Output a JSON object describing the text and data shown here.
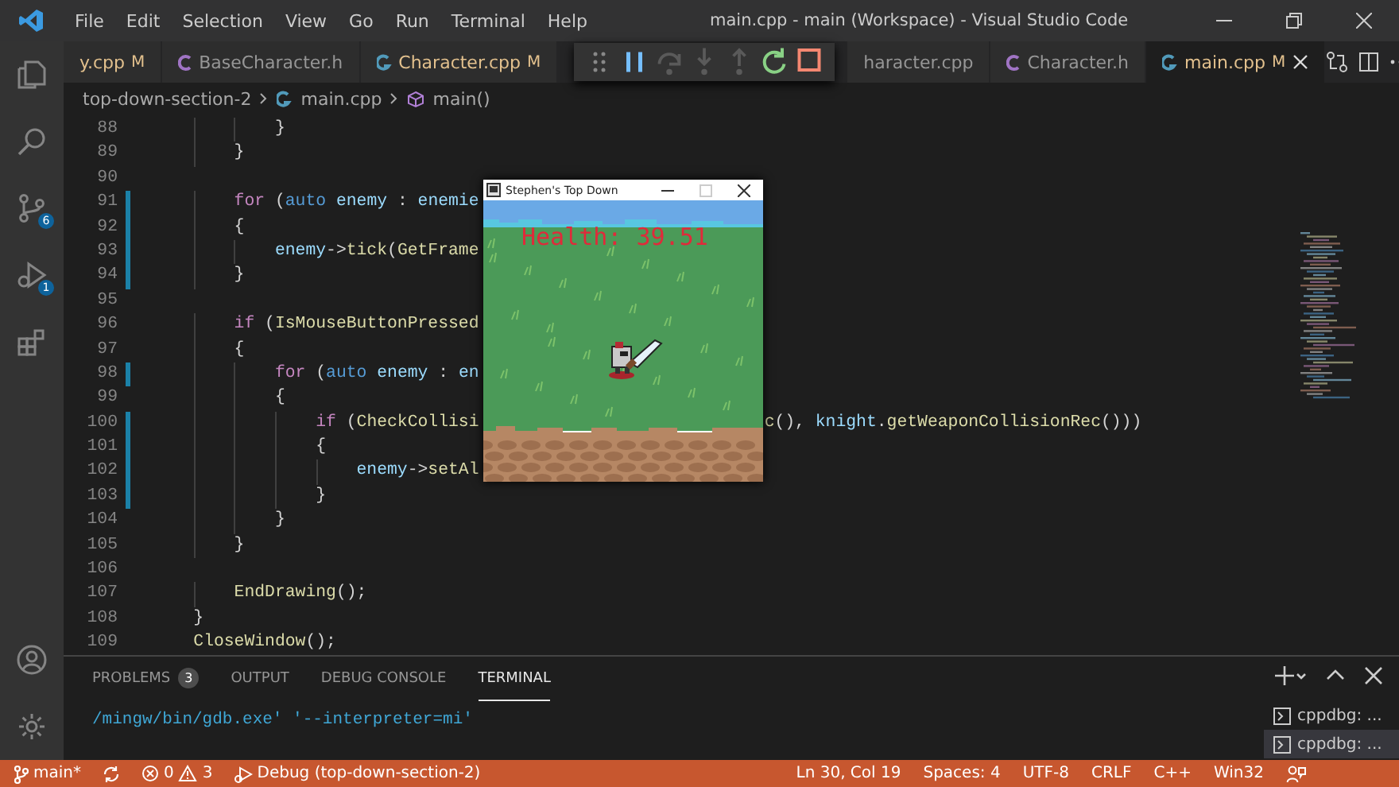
{
  "window": {
    "title": "main.cpp - main (Workspace) - Visual Studio Code"
  },
  "menu": [
    "File",
    "Edit",
    "Selection",
    "View",
    "Go",
    "Run",
    "Terminal",
    "Help"
  ],
  "activity_bar": {
    "top": [
      {
        "kind": "explorer"
      },
      {
        "kind": "search"
      },
      {
        "kind": "source-control",
        "badge": "6"
      },
      {
        "kind": "run-debug",
        "badge": "1"
      },
      {
        "kind": "extensions"
      }
    ],
    "bottom": [
      {
        "kind": "account"
      },
      {
        "kind": "settings"
      }
    ]
  },
  "tabs": [
    {
      "label": "y.cpp",
      "kind": "plain",
      "modified": true,
      "badge": "M",
      "selected": false
    },
    {
      "label": "BaseCharacter.h",
      "kind": "header",
      "modified": false,
      "selected": false
    },
    {
      "label": "Character.cpp",
      "kind": "source",
      "modified": true,
      "badge": "M",
      "selected": false
    },
    {
      "label": "haracter.cpp",
      "kind": "plain",
      "modified": false,
      "selected": false
    },
    {
      "label": "Character.h",
      "kind": "header",
      "modified": false,
      "selected": false
    },
    {
      "label": "main.cpp",
      "kind": "source",
      "modified": true,
      "badge": "M",
      "selected": true
    }
  ],
  "debug_toolbar": [
    {
      "kind": "grip",
      "disabled": false
    },
    {
      "kind": "pause",
      "disabled": false
    },
    {
      "kind": "step-over",
      "disabled": true
    },
    {
      "kind": "step-into",
      "disabled": true
    },
    {
      "kind": "step-out",
      "disabled": true
    },
    {
      "kind": "restart",
      "disabled": false
    },
    {
      "kind": "stop",
      "disabled": false
    }
  ],
  "breadcrumb": {
    "folder": "top-down-section-2",
    "file": "main.cpp",
    "symbol": "main()"
  },
  "code_lines": [
    {
      "number": "88",
      "changed": false,
      "tokens": [
        {
          "kind": "punct",
          "text": "            }"
        }
      ]
    },
    {
      "number": "89",
      "changed": false,
      "tokens": [
        {
          "kind": "punct",
          "text": "        }"
        }
      ]
    },
    {
      "number": "90",
      "changed": false
    },
    {
      "number": "91",
      "changed": true,
      "tokens": [
        {
          "kind": "keyword",
          "text": "        for"
        },
        {
          "kind": "punct",
          "text": " ("
        },
        {
          "kind": "type",
          "text": "auto"
        },
        {
          "kind": "var",
          "text": " enemy"
        },
        {
          "kind": "punct",
          "text": " : "
        },
        {
          "kind": "var",
          "text": "enemie"
        }
      ]
    },
    {
      "number": "92",
      "changed": true,
      "tokens": [
        {
          "kind": "punct",
          "text": "        {"
        }
      ]
    },
    {
      "number": "93",
      "changed": true,
      "tokens": [
        {
          "kind": "var",
          "text": "            enemy"
        },
        {
          "kind": "punct",
          "text": "->"
        },
        {
          "kind": "fn",
          "text": "tick"
        },
        {
          "kind": "punct",
          "text": "("
        },
        {
          "kind": "fn",
          "text": "GetFrame"
        }
      ]
    },
    {
      "number": "94",
      "changed": true,
      "tokens": [
        {
          "kind": "punct",
          "text": "        }"
        }
      ]
    },
    {
      "number": "95",
      "changed": false
    },
    {
      "number": "96",
      "changed": false,
      "tokens": [
        {
          "kind": "keyword",
          "text": "        if"
        },
        {
          "kind": "punct",
          "text": " ("
        },
        {
          "kind": "fn",
          "text": "IsMouseButtonPressed"
        }
      ]
    },
    {
      "number": "97",
      "changed": false,
      "tokens": [
        {
          "kind": "punct",
          "text": "        {"
        }
      ]
    },
    {
      "number": "98",
      "changed": true,
      "tokens": [
        {
          "kind": "keyword",
          "text": "            for"
        },
        {
          "kind": "punct",
          "text": " ("
        },
        {
          "kind": "type",
          "text": "auto"
        },
        {
          "kind": "var",
          "text": " enemy"
        },
        {
          "kind": "punct",
          "text": " : "
        },
        {
          "kind": "var",
          "text": "en"
        }
      ]
    },
    {
      "number": "99",
      "changed": false,
      "tokens": [
        {
          "kind": "punct",
          "text": "            {"
        }
      ]
    },
    {
      "number": "100",
      "changed": true,
      "tokens": [
        {
          "kind": "keyword",
          "text": "                if"
        },
        {
          "kind": "punct",
          "text": " ("
        },
        {
          "kind": "fn",
          "text": "CheckCollisi"
        }
      ],
      "tail": [
        {
          "kind": "fn",
          "text": "c"
        },
        {
          "kind": "punct",
          "text": "(), "
        },
        {
          "kind": "var",
          "text": "knight"
        },
        {
          "kind": "punct",
          "text": "."
        },
        {
          "kind": "fn",
          "text": "getWeaponCollisionRec"
        },
        {
          "kind": "punct",
          "text": "()))"
        }
      ]
    },
    {
      "number": "101",
      "changed": true,
      "tokens": [
        {
          "kind": "punct",
          "text": "                {"
        }
      ]
    },
    {
      "number": "102",
      "changed": true,
      "tokens": [
        {
          "kind": "var",
          "text": "                    enemy"
        },
        {
          "kind": "punct",
          "text": "->"
        },
        {
          "kind": "fn",
          "text": "setAl"
        }
      ]
    },
    {
      "number": "103",
      "changed": true,
      "tokens": [
        {
          "kind": "punct",
          "text": "                }"
        }
      ]
    },
    {
      "number": "104",
      "changed": false,
      "tokens": [
        {
          "kind": "punct",
          "text": "            }"
        }
      ]
    },
    {
      "number": "105",
      "changed": false,
      "tokens": [
        {
          "kind": "punct",
          "text": "        }"
        }
      ]
    },
    {
      "number": "106",
      "changed": false
    },
    {
      "number": "107",
      "changed": false,
      "tokens": [
        {
          "kind": "fn",
          "text": "        EndDrawing"
        },
        {
          "kind": "punct",
          "text": "();"
        }
      ]
    },
    {
      "number": "108",
      "changed": false,
      "tokens": [
        {
          "kind": "punct",
          "text": "    }"
        }
      ]
    },
    {
      "number": "109",
      "changed": false,
      "tokens": [
        {
          "kind": "fn",
          "text": "    CloseWindow"
        },
        {
          "kind": "punct",
          "text": "();"
        }
      ]
    }
  ],
  "game_window": {
    "title": "Stephen's Top Down",
    "health_text": "Health: 39.51"
  },
  "panel": {
    "tabs": [
      {
        "label": "PROBLEMS",
        "badge": "3",
        "selected": false
      },
      {
        "label": "OUTPUT",
        "selected": false
      },
      {
        "label": "DEBUG CONSOLE",
        "selected": false
      },
      {
        "label": "TERMINAL",
        "selected": true
      }
    ],
    "terminal_text": "/mingw/bin/gdb.exe' '--interpreter=mi'",
    "terminals": [
      {
        "label": "cppdbg: ...",
        "selected": false
      },
      {
        "label": "cppdbg: ...",
        "selected": true
      }
    ]
  },
  "status_bar": {
    "left": [
      {
        "kind": "branch",
        "text": "main*"
      },
      {
        "kind": "sync"
      },
      {
        "kind": "problems",
        "errors": "0",
        "warnings": "3"
      },
      {
        "kind": "debug",
        "text": "Debug (top-down-section-2)"
      }
    ],
    "right": [
      {
        "kind": "text",
        "text": "Ln 30, Col 19"
      },
      {
        "kind": "text",
        "text": "Spaces: 4"
      },
      {
        "kind": "text",
        "text": "UTF-8"
      },
      {
        "kind": "text",
        "text": "CRLF"
      },
      {
        "kind": "text",
        "text": "C++"
      },
      {
        "kind": "text",
        "text": "Win32"
      },
      {
        "kind": "feedback"
      }
    ]
  }
}
